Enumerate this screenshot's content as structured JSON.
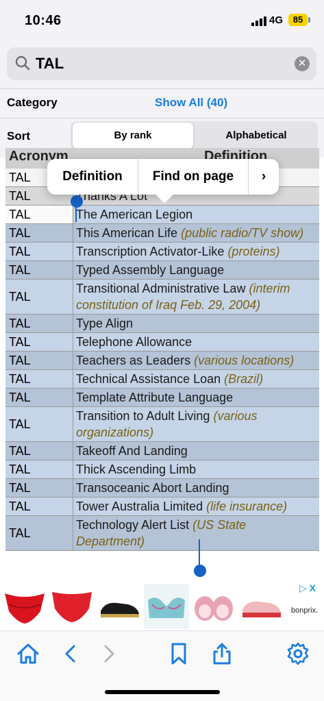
{
  "status": {
    "time": "10:46",
    "network": "4G",
    "battery": "85",
    "battery_color": "#f5d300"
  },
  "search": {
    "value": "TAL",
    "icon": "magnifier-icon",
    "clear_icon": "clear-x-icon"
  },
  "filters": {
    "category_label": "Category",
    "category_value": "Show All (40)",
    "sort_label": "Sort",
    "sort_options": [
      "By rank",
      "Alphabetical"
    ],
    "sort_selected": "By rank"
  },
  "table": {
    "headers": [
      "Acronym",
      "Definition"
    ],
    "rows": [
      {
        "acronym": "TAL",
        "text": "",
        "note": ""
      },
      {
        "acronym": "TAL",
        "text": "Thanks A Lot",
        "note": ""
      },
      {
        "acronym": "TAL",
        "text": "The American Legion",
        "note": ""
      },
      {
        "acronym": "TAL",
        "text": "This American Life",
        "note": "(public radio/TV show)"
      },
      {
        "acronym": "TAL",
        "text": "Transcription Activator-Like",
        "note": "(proteins)"
      },
      {
        "acronym": "TAL",
        "text": "Typed Assembly Language",
        "note": ""
      },
      {
        "acronym": "TAL",
        "text": "Transitional Administrative Law",
        "note": "(interim constitution of Iraq Feb. 29, 2004)"
      },
      {
        "acronym": "TAL",
        "text": "Type Align",
        "note": ""
      },
      {
        "acronym": "TAL",
        "text": "Telephone Allowance",
        "note": ""
      },
      {
        "acronym": "TAL",
        "text": "Teachers as Leaders",
        "note": "(various locations)"
      },
      {
        "acronym": "TAL",
        "text": "Technical Assistance Loan",
        "note": "(Brazil)"
      },
      {
        "acronym": "TAL",
        "text": "Template Attribute Language",
        "note": ""
      },
      {
        "acronym": "TAL",
        "text": "Transition to Adult Living",
        "note": "(various organizations)"
      },
      {
        "acronym": "TAL",
        "text": "Takeoff And Landing",
        "note": ""
      },
      {
        "acronym": "TAL",
        "text": "Thick Ascending Limb",
        "note": ""
      },
      {
        "acronym": "TAL",
        "text": "Transoceanic Abort Landing",
        "note": ""
      },
      {
        "acronym": "TAL",
        "text": "Tower Australia Limited",
        "note": "(life insurance)"
      },
      {
        "acronym": "TAL",
        "text": "Technology Alert List",
        "note": "(US State Department)"
      }
    ],
    "selection_color": "#78a0d2",
    "note_color": "#7a6116"
  },
  "popup": {
    "items": [
      "Definition",
      "Find on page"
    ],
    "more_icon": "chevron-right-icon"
  },
  "ad": {
    "brand": "bonprix.",
    "close_label": "▷ X",
    "items": [
      "red-lace-panty-image",
      "red-brief-image",
      "black-sneaker-image",
      "teal-lace-bra-image",
      "pink-bra-image",
      "pink-sneaker-image"
    ]
  },
  "toolbar": {
    "icons": [
      "home-icon",
      "back-icon",
      "forward-icon",
      "bookmark-icon",
      "share-icon",
      "settings-icon"
    ],
    "accent": "#1a7de0"
  }
}
